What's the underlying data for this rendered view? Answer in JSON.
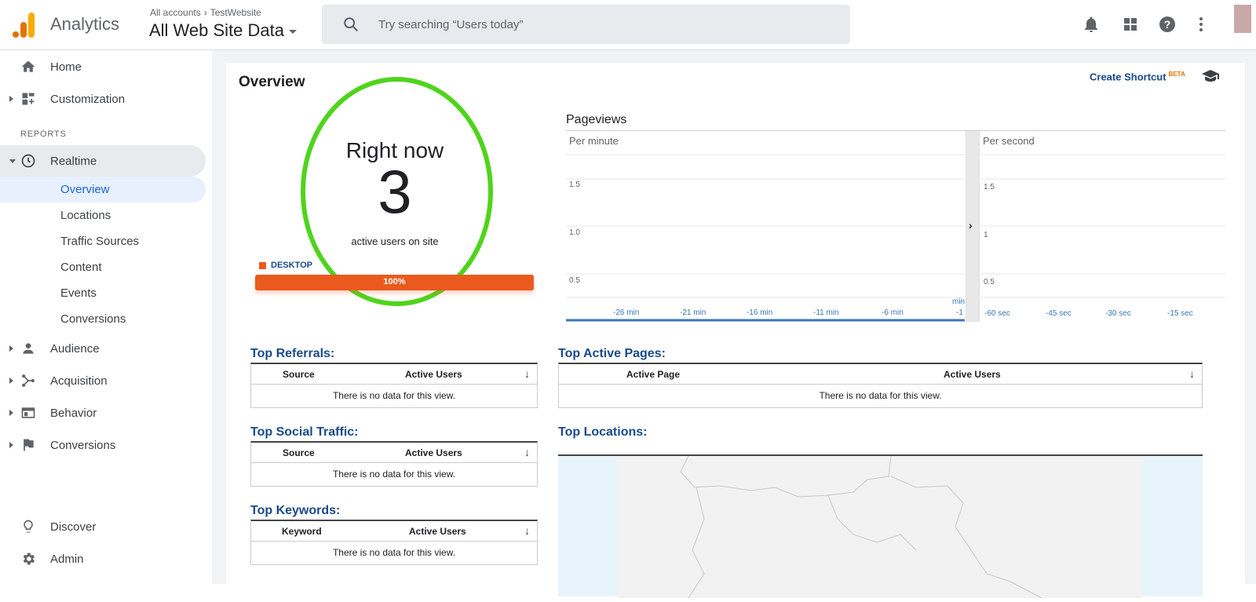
{
  "header": {
    "app_name": "Analytics",
    "account_crumb": "All accounts",
    "property_crumb": "TestWebsite",
    "view_name": "All Web Site Data",
    "search_placeholder": "Try searching “Users today”"
  },
  "sidebar": {
    "items_top": [
      {
        "label": "Home"
      },
      {
        "label": "Customization"
      }
    ],
    "reports_label": "REPORTS",
    "realtime": {
      "label": "Realtime",
      "children": [
        "Overview",
        "Locations",
        "Traffic Sources",
        "Content",
        "Events",
        "Conversions"
      ]
    },
    "items_reports": [
      {
        "label": "Audience"
      },
      {
        "label": "Acquisition"
      },
      {
        "label": "Behavior"
      },
      {
        "label": "Conversions"
      }
    ],
    "items_bottom": [
      {
        "label": "Discover"
      },
      {
        "label": "Admin"
      }
    ]
  },
  "overview": {
    "title": "Overview",
    "create_shortcut": "Create Shortcut",
    "beta": "BETA",
    "right_now_title": "Right now",
    "active_count": "3",
    "active_sub": "active users on site",
    "device_label": "DESKTOP",
    "device_pct_label": "100%",
    "device_pct_value": 100
  },
  "pageviews": {
    "title": "Pageviews",
    "per_minute": "Per minute",
    "per_second": "Per second",
    "minute_yticks": [
      "1.5",
      "1.0",
      "0.5"
    ],
    "second_yticks": [
      "1.5",
      "1",
      "0.5"
    ],
    "minute_xticks": [
      "-26 min",
      "-21 min",
      "-16 min",
      "-11 min",
      "-6 min",
      "-1"
    ],
    "minute_unit": "min",
    "second_xticks": [
      "-60 sec",
      "-45 sec",
      "-30 sec",
      "-15 sec"
    ]
  },
  "tables": {
    "referrals": {
      "title": "Top Referrals:",
      "col1": "Source",
      "col2": "Active Users",
      "empty": "There is no data for this view."
    },
    "social": {
      "title": "Top Social Traffic:",
      "col1": "Source",
      "col2": "Active Users",
      "empty": "There is no data for this view."
    },
    "keywords": {
      "title": "Top Keywords:",
      "col1": "Keyword",
      "col2": "Active Users",
      "empty": "There is no data for this view."
    },
    "pages": {
      "title": "Top Active Pages:",
      "col1": "Active Page",
      "col2": "Active Users",
      "empty": "There is no data for this view."
    },
    "locations": {
      "title": "Top Locations:"
    }
  },
  "colors": {
    "accent": "#1a4a8a",
    "device": "#ea5a1e",
    "highlight_ring": "#4fd41c",
    "logo_orange": "#e37400",
    "logo_yellow": "#f9ab00"
  }
}
